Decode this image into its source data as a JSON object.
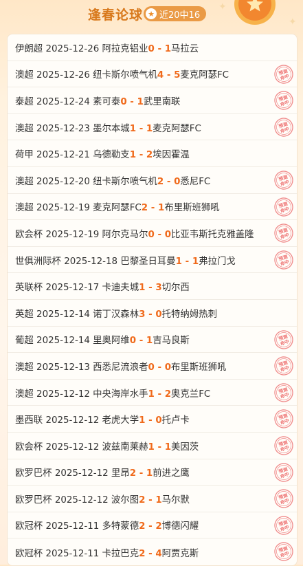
{
  "header": {
    "title": "逢春论球",
    "badge_text": "近20中16"
  },
  "stamp_label": "预测命中",
  "matches": [
    {
      "league": "伊朗超",
      "date": "2025-12-26",
      "home": "阿拉克铝业",
      "home_score": "0",
      "away_score": "1",
      "away": "马拉云",
      "hit": false
    },
    {
      "league": "澳超",
      "date": "2025-12-26",
      "home": "纽卡斯尔喷气机",
      "home_score": "4",
      "away_score": "5",
      "away": "麦克阿瑟FC",
      "hit": true
    },
    {
      "league": "泰超",
      "date": "2025-12-24",
      "home": "素可泰",
      "home_score": "0",
      "away_score": "1",
      "away": "武里南联",
      "hit": true
    },
    {
      "league": "澳超",
      "date": "2025-12-23",
      "home": "墨尔本城",
      "home_score": "1",
      "away_score": "1",
      "away": "麦克阿瑟FC",
      "hit": true
    },
    {
      "league": "荷甲",
      "date": "2025-12-21",
      "home": "乌德勒支",
      "home_score": "1",
      "away_score": "2",
      "away": "埃因霍温",
      "hit": false
    },
    {
      "league": "澳超",
      "date": "2025-12-20",
      "home": "纽卡斯尔喷气机",
      "home_score": "2",
      "away_score": "0",
      "away": "悉尼FC",
      "hit": true
    },
    {
      "league": "澳超",
      "date": "2025-12-19",
      "home": "麦克阿瑟FC",
      "home_score": "2",
      "away_score": "1",
      "away": "布里斯班狮吼",
      "hit": true
    },
    {
      "league": "欧会杯",
      "date": "2025-12-19",
      "home": "阿尔克马尔",
      "home_score": "0",
      "away_score": "0",
      "away": "比亚韦斯托克雅盖隆",
      "hit": true
    },
    {
      "league": "世俱洲际杯",
      "date": "2025-12-18",
      "home": "巴黎圣日耳曼",
      "home_score": "1",
      "away_score": "1",
      "away": "弗拉门戈",
      "hit": true
    },
    {
      "league": "英联杯",
      "date": "2025-12-17",
      "home": "卡迪夫城",
      "home_score": "1",
      "away_score": "3",
      "away": "切尔西",
      "hit": false
    },
    {
      "league": "英超",
      "date": "2025-12-14",
      "home": "诺丁汉森林",
      "home_score": "3",
      "away_score": "0",
      "away": "托特纳姆热刺",
      "hit": false
    },
    {
      "league": "葡超",
      "date": "2025-12-14",
      "home": "里奥阿维",
      "home_score": "0",
      "away_score": "1",
      "away": "吉马良斯",
      "hit": true
    },
    {
      "league": "澳超",
      "date": "2025-12-13",
      "home": "西悉尼流浪者",
      "home_score": "0",
      "away_score": "0",
      "away": "布里斯班狮吼",
      "hit": true
    },
    {
      "league": "澳超",
      "date": "2025-12-12",
      "home": "中央海岸水手",
      "home_score": "1",
      "away_score": "2",
      "away": "奥克兰FC",
      "hit": true
    },
    {
      "league": "墨西联",
      "date": "2025-12-12",
      "home": "老虎大学",
      "home_score": "1",
      "away_score": "0",
      "away": "托卢卡",
      "hit": true
    },
    {
      "league": "欧会杯",
      "date": "2025-12-12",
      "home": "波兹南莱赫",
      "home_score": "1",
      "away_score": "1",
      "away": "美因茨",
      "hit": true
    },
    {
      "league": "欧罗巴杯",
      "date": "2025-12-12",
      "home": "里昂",
      "home_score": "2",
      "away_score": "1",
      "away": "前进之鹰",
      "hit": true
    },
    {
      "league": "欧罗巴杯",
      "date": "2025-12-12",
      "home": "波尔图",
      "home_score": "2",
      "away_score": "1",
      "away": "马尔默",
      "hit": true
    },
    {
      "league": "欧冠杯",
      "date": "2025-12-11",
      "home": "多特蒙德",
      "home_score": "2",
      "away_score": "2",
      "away": "博德闪耀",
      "hit": true
    },
    {
      "league": "欧冠杯",
      "date": "2025-12-11",
      "home": "卡拉巴克",
      "home_score": "2",
      "away_score": "4",
      "away": "阿贾克斯",
      "hit": true
    }
  ]
}
